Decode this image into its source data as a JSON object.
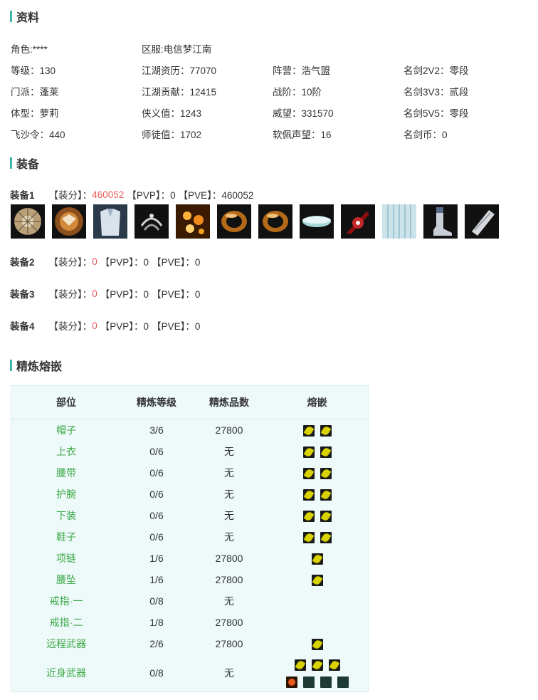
{
  "sections": {
    "profile_title": "资料",
    "equipment_title": "装备",
    "refine_title": "精炼熔嵌"
  },
  "profile": {
    "role": "角色:****",
    "server": "区服:电信梦江南",
    "level": "等级：130",
    "experience": "江湖资历：77070",
    "camp": "阵营：浩气盟",
    "rank_2v2": "名剑2V2：零段",
    "school": "门派：蓬莱",
    "contribution": "江湖贡献：12415",
    "war_rank": "战阶：10阶",
    "rank_3v3": "名剑3V3：贰段",
    "body": "体型：萝莉",
    "chivalry": "侠义值：1243",
    "prestige": "威望：331570",
    "rank_5v5": "名剑5V5：零段",
    "flysand": "飞沙令：440",
    "mentor": "师徒值：1702",
    "ruanpei": "软佩声望：16",
    "coin": "名剑币：0"
  },
  "equipment_sets": [
    {
      "label": "装备1",
      "score_label": "【装分】：",
      "score": "460052",
      "pvp": "【PVP】：0",
      "pve": "【PVE】：460052"
    },
    {
      "label": "装备2",
      "score_label": "【装分】：",
      "score": "0",
      "pvp": "【PVP】：0",
      "pve": "【PVE】：0"
    },
    {
      "label": "装备3",
      "score_label": "【装分】：",
      "score": "0",
      "pvp": "【PVP】：0",
      "pve": "【PVE】：0"
    },
    {
      "label": "装备4",
      "score_label": "【装分】：",
      "score": "0",
      "pvp": "【PVP】：0",
      "pve": "【PVE】：0"
    }
  ],
  "equipment_icons": [
    "hat-icon",
    "shoulder-icon",
    "robe-icon",
    "belt-icon",
    "necklace-icon",
    "ring-icon",
    "ring-icon",
    "waist-pendant-icon",
    "weapon-icon",
    "skirt-icon",
    "boots-icon",
    "bracer-icon"
  ],
  "refine_table": {
    "headers": [
      "部位",
      "精炼等级",
      "精炼品数",
      "熔嵌"
    ],
    "rows": [
      {
        "part": "帽子",
        "level": "3/6",
        "quality": "27800",
        "gems": 2
      },
      {
        "part": "上衣",
        "level": "0/6",
        "quality": "无",
        "gems": 2
      },
      {
        "part": "腰带",
        "level": "0/6",
        "quality": "无",
        "gems": 2
      },
      {
        "part": "护腕",
        "level": "0/6",
        "quality": "无",
        "gems": 2
      },
      {
        "part": "下装",
        "level": "0/6",
        "quality": "无",
        "gems": 2
      },
      {
        "part": "鞋子",
        "level": "0/6",
        "quality": "无",
        "gems": 2
      },
      {
        "part": "项链",
        "level": "1/6",
        "quality": "27800",
        "gems": 1
      },
      {
        "part": "腰坠",
        "level": "1/6",
        "quality": "27800",
        "gems": 1
      },
      {
        "part": "戒指·一",
        "level": "0/8",
        "quality": "无",
        "gems": 0
      },
      {
        "part": "戒指·二",
        "level": "1/8",
        "quality": "27800",
        "gems": 0
      },
      {
        "part": "远程武器",
        "level": "2/6",
        "quality": "27800",
        "gems": 1
      },
      {
        "part": "近身武器",
        "level": "0/8",
        "quality": "无",
        "gems": 3,
        "extra": true
      }
    ]
  },
  "colors": {
    "accent": "#3fb4a8",
    "score_red": "#e85a5a",
    "part_green": "#3aa845",
    "table_bg": "#eef9fa"
  }
}
